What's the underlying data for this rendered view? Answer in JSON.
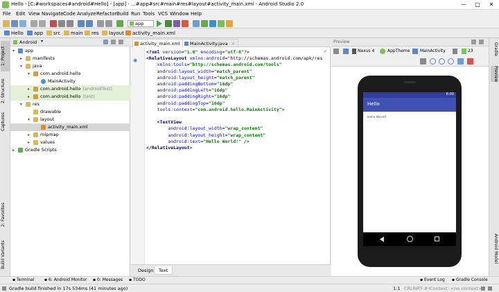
{
  "window": {
    "title": "Hello - [C:#workspaces#android#Hello] - [app] - ...#app#src#main#res#layout#activity_main.xml - Android Studio 2.0",
    "controls": [
      "—",
      "□",
      "✕"
    ]
  },
  "menu": [
    "File",
    "Edit",
    "View",
    "Navigate",
    "Code",
    "Analyze",
    "Refactor",
    "Build",
    "Run",
    "Tools",
    "VCS",
    "Window",
    "Help"
  ],
  "toolbar": {
    "run_config": "app"
  },
  "breadcrumbs": [
    "Hello",
    "app",
    "src",
    "main",
    "res",
    "layout",
    "activity_main.xml"
  ],
  "left_tool_tabs": {
    "project": "1: Project",
    "structure": "2: Structure",
    "captures": "Captures",
    "favorites": "2: Favorites",
    "build_variants": "Build Variants"
  },
  "right_tool_tabs": {
    "gradle": "Gradle",
    "preview": "Preview",
    "android_model": "Android Model"
  },
  "project": {
    "view_mode": "Android",
    "tree": [
      {
        "label": "app",
        "depth": 0,
        "arrow": "▾",
        "icon": "module"
      },
      {
        "label": "manifests",
        "depth": 1,
        "arrow": "▸",
        "icon": "folder"
      },
      {
        "label": "java",
        "depth": 1,
        "arrow": "▾",
        "icon": "folder"
      },
      {
        "label": "com.android.hello",
        "depth": 2,
        "arrow": "▾",
        "icon": "package"
      },
      {
        "label": "MainActivity",
        "depth": 3,
        "arrow": "",
        "icon": "class"
      },
      {
        "label": "com.android.hello",
        "suffix": "(androidTest)",
        "depth": 2,
        "arrow": "▸",
        "icon": "package",
        "highlight": "green"
      },
      {
        "label": "com.android.hello",
        "suffix": "(test)",
        "depth": 2,
        "arrow": "▸",
        "icon": "package",
        "highlight": "green"
      },
      {
        "label": "res",
        "depth": 1,
        "arrow": "▾",
        "icon": "folder"
      },
      {
        "label": "drawable",
        "depth": 2,
        "arrow": "",
        "icon": "folder"
      },
      {
        "label": "layout",
        "depth": 2,
        "arrow": "▾",
        "icon": "folder"
      },
      {
        "label": "activity_main.xml",
        "depth": 3,
        "arrow": "",
        "icon": "xml",
        "highlight": "selected"
      },
      {
        "label": "mipmap",
        "depth": 2,
        "arrow": "▸",
        "icon": "folder"
      },
      {
        "label": "values",
        "depth": 2,
        "arrow": "▸",
        "icon": "folder"
      },
      {
        "label": "Gradle Scripts",
        "depth": 0,
        "arrow": "▸",
        "icon": "gradle"
      }
    ]
  },
  "editor": {
    "tabs": [
      {
        "label": "activity_main.xml",
        "active": true
      },
      {
        "label": "MainActivity.java",
        "active": false
      }
    ],
    "code_lines": [
      "<?xml version=\"1.0\" encoding=\"utf-8\"?>",
      "<RelativeLayout xmlns:android=\"http://schemas.android.com/apk/res",
      "    xmlns:tools=\"http://schemas.android.com/tools\"",
      "    android:layout_width=\"match_parent\"",
      "    android:layout_height=\"match_parent\"",
      "    android:paddingBottom=\"16dp\"",
      "    android:paddingLeft=\"16dp\"",
      "    android:paddingRight=\"16dp\"",
      "    android:paddingTop=\"16dp\"",
      "    tools:context=\"com.android.hello.MainActivity\">",
      "",
      "    <TextView",
      "        android:layout_width=\"wrap_content\"",
      "        android:layout_height=\"wrap_content\"",
      "        android:text=\"Hello World!\" />",
      "</RelativeLayout>"
    ],
    "bottom_tabs": [
      "Design",
      "Text"
    ]
  },
  "preview": {
    "header": "Preview",
    "device": "Nexus 4",
    "theme": "AppTheme",
    "activity": "MainActivity",
    "api": "23",
    "phone": {
      "time": "6:00",
      "app_title": "Hello",
      "content_text": "Hello World!"
    }
  },
  "bottom_tools": [
    "Terminal",
    "6: Android Monitor",
    "0: Messages",
    "TODO",
    "Event Log",
    "Gradle Console"
  ],
  "status": {
    "message": "Gradle build finished in 17s 534ms (41 minutes ago)",
    "position": "1:1",
    "line_sep": "CRLF÷",
    "encoding": "UTF-8÷",
    "context": "Context: <no context>"
  }
}
